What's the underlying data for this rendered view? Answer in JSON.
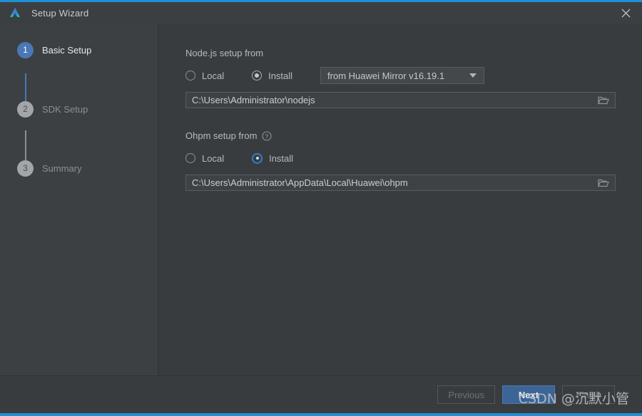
{
  "window": {
    "title": "Setup Wizard",
    "app_icon": "deveco-logo-icon",
    "close_icon": "close-icon",
    "accent_color": "#1d8fd6"
  },
  "sidebar": {
    "steps": [
      {
        "number": "1",
        "label": "Basic Setup",
        "state": "active"
      },
      {
        "number": "2",
        "label": "SDK Setup",
        "state": "idle"
      },
      {
        "number": "3",
        "label": "Summary",
        "state": "idle"
      }
    ]
  },
  "main": {
    "nodejs": {
      "section_label": "Node.js setup from",
      "local_label": "Local",
      "install_label": "Install",
      "selected": "Install",
      "mirror_value": "from Huawei Mirror v16.19.1",
      "mirror_options": [
        "from Huawei Mirror v16.19.1"
      ],
      "path_value": "C:\\Users\\Administrator\\nodejs",
      "browse_icon": "folder-icon"
    },
    "ohpm": {
      "section_label": "Ohpm setup from",
      "help_icon": "help-circle-icon",
      "local_label": "Local",
      "install_label": "Install",
      "selected": "Install",
      "path_value": "C:\\Users\\Administrator\\AppData\\Local\\Huawei\\ohpm",
      "browse_icon": "folder-icon"
    }
  },
  "footer": {
    "previous_label": "Previous",
    "next_label": "Next",
    "finish_label": "Finish"
  },
  "watermark": {
    "text": "CSDN @沉默小管"
  }
}
